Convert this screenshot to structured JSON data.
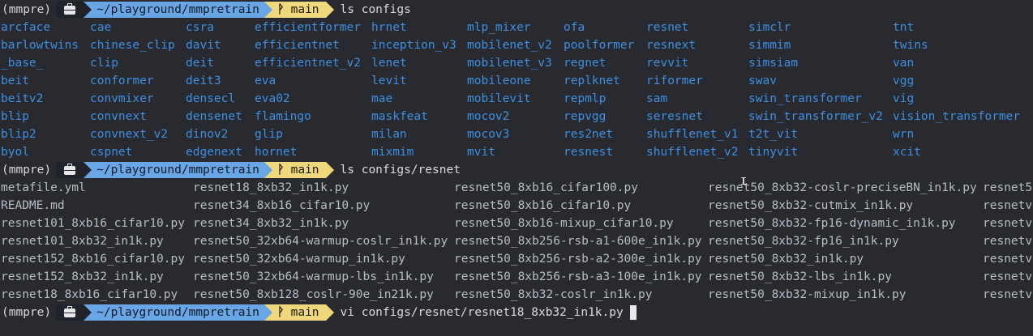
{
  "prompt": {
    "env": "(mmpre)",
    "path": "~/playground/mmpretrain",
    "branch": "main",
    "icons": {
      "tool": "briefcase-icon",
      "git": "git-branch-icon"
    }
  },
  "commands": [
    "ls configs",
    "ls configs/resnet",
    "vi configs/resnet/resnet18_8xb32_in1k.py"
  ],
  "configs_columns": [
    [
      "arcface",
      "barlowtwins",
      "_base_",
      "beit",
      "beitv2",
      "blip",
      "blip2",
      "byol"
    ],
    [
      "cae",
      "chinese_clip",
      "clip",
      "conformer",
      "convmixer",
      "convnext",
      "convnext_v2",
      "cspnet"
    ],
    [
      "csra",
      "davit",
      "deit",
      "deit3",
      "densecl",
      "densenet",
      "dinov2",
      "edgenext"
    ],
    [
      "efficientformer",
      "efficientnet",
      "efficientnet_v2",
      "eva",
      "eva02",
      "flamingo",
      "glip",
      "hornet"
    ],
    [
      "hrnet",
      "inception_v3",
      "lenet",
      "levit",
      "mae",
      "maskfeat",
      "milan",
      "mixmim"
    ],
    [
      "mlp_mixer",
      "mobilenet_v2",
      "mobilenet_v3",
      "mobileone",
      "mobilevit",
      "mocov2",
      "mocov3",
      "mvit"
    ],
    [
      "ofa",
      "poolformer",
      "regnet",
      "replknet",
      "repmlp",
      "repvgg",
      "res2net",
      "resnest"
    ],
    [
      "resnet",
      "resnext",
      "revvit",
      "riformer",
      "sam",
      "seresnet",
      "shufflenet_v1",
      "shufflenet_v2"
    ],
    [
      "simclr",
      "simmim",
      "simsiam",
      "swav",
      "swin_transformer",
      "swin_transformer_v2",
      "t2t_vit",
      "tinyvit"
    ],
    [
      "tnt",
      "twins",
      "van",
      "vgg",
      "vig",
      "vision_transformer",
      "wrn",
      "xcit"
    ]
  ],
  "resnet_columns": [
    [
      "metafile.yml",
      "README.md",
      "resnet101_8xb16_cifar10.py",
      "resnet101_8xb32_in1k.py",
      "resnet152_8xb16_cifar10.py",
      "resnet152_8xb32_in1k.py",
      "resnet18_8xb16_cifar10.py"
    ],
    [
      "resnet18_8xb32_in1k.py",
      "resnet34_8xb16_cifar10.py",
      "resnet34_8xb32_in1k.py",
      "resnet50_32xb64-warmup-coslr_in1k.py",
      "resnet50_32xb64-warmup_in1k.py",
      "resnet50_32xb64-warmup-lbs_in1k.py",
      "resnet50_8xb128_coslr-90e_in21k.py"
    ],
    [
      "resnet50_8xb16_cifar100.py",
      "resnet50_8xb16_cifar10.py",
      "resnet50_8xb16-mixup_cifar10.py",
      "resnet50_8xb256-rsb-a1-600e_in1k.py",
      "resnet50_8xb256-rsb-a2-300e_in1k.py",
      "resnet50_8xb256-rsb-a3-100e_in1k.py",
      "resnet50_8xb32-coslr_in1k.py"
    ],
    [
      "resnet50_8xb32-coslr-preciseBN_in1k.py",
      "resnet50_8xb32-cutmix_in1k.py",
      "resnet50_8xb32-fp16-dynamic_in1k.py",
      "resnet50_8xb32-fp16_in1k.py",
      "resnet50_8xb32_in1k.py",
      "resnet50_8xb32-lbs_in1k.py",
      "resnet50_8xb32-mixup_in1k.py"
    ],
    [
      "resnet5",
      "resnetv",
      "resnetv",
      "resnetv",
      "resnetv",
      "resnetv",
      "resnetv"
    ]
  ]
}
